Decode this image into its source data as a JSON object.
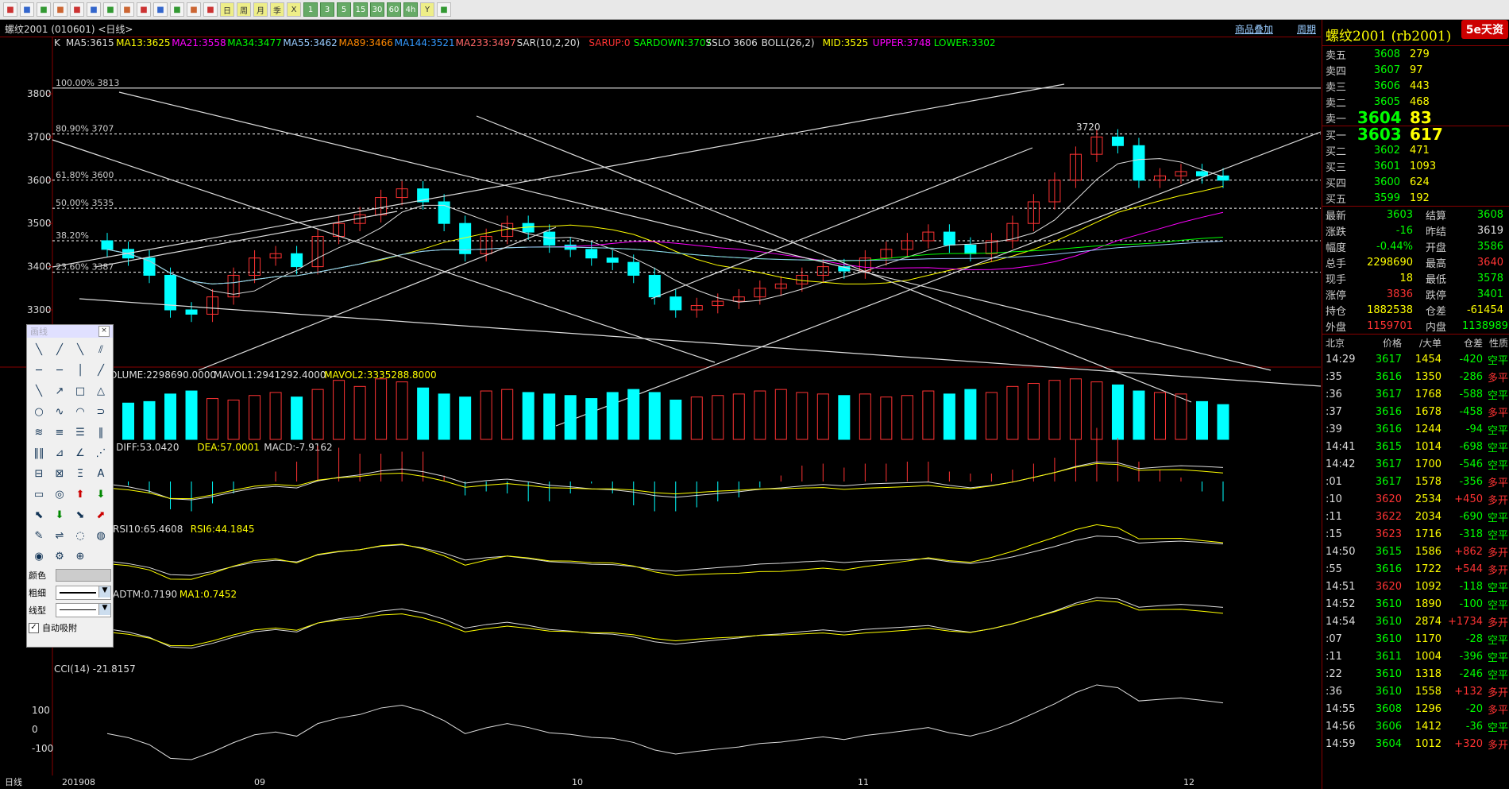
{
  "toolbar": {
    "buttons": [
      "home-icon",
      "back-icon",
      "list-icon",
      "refresh-icon",
      "zoom-in-icon",
      "zoom-out-icon",
      "window-icon",
      "pen-icon",
      "draw-icon",
      "mark-icon",
      "grid-icon",
      "table-icon",
      "chart-icon",
      "day-icon",
      "week-icon",
      "month-icon",
      "season-icon",
      "x-icon",
      "1-icon",
      "3-icon",
      "5-icon",
      "15-icon",
      "30-icon",
      "60-icon",
      "4h-icon",
      "y-icon",
      "calc-icon"
    ],
    "labels": [
      "",
      "",
      "",
      "",
      "",
      "",
      "",
      "",
      "",
      "",
      "",
      "",
      "",
      "日",
      "周",
      "月",
      "季",
      "X",
      "1",
      "3",
      "5",
      "15",
      "30",
      "60",
      "4h",
      "Y",
      ""
    ]
  },
  "title": {
    "text": "螺纹2001 (010601) <日线>",
    "overlay_link": "商品叠加",
    "period_link": "周期"
  },
  "indicators": {
    "main": "K  MA5:3615  MA13:3625  MA21:3558  MA34:3477  MA55:3462  MA89:3466  MA144:3521  MA233:3497  SAR(10,2,20)  SARUP:0  SARDOWN:3707  SSLO 3606  BOLL(26,2)  MID:3525  UPPER:3748  LOWER:3302",
    "main_parts": [
      {
        "t": "K",
        "c": "#ddd"
      },
      {
        "t": "MA5:3615",
        "c": "#ddd"
      },
      {
        "t": "MA13:3625",
        "c": "#ff0"
      },
      {
        "t": "MA21:3558",
        "c": "#f0f"
      },
      {
        "t": "MA34:3477",
        "c": "#0f0"
      },
      {
        "t": "MA55:3462",
        "c": "#9cf"
      },
      {
        "t": "MA89:3466",
        "c": "#f80"
      },
      {
        "t": "MA144:3521",
        "c": "#39f"
      },
      {
        "t": "MA233:3497",
        "c": "#f66"
      },
      {
        "t": "SAR(10,2,20)",
        "c": "#ddd"
      },
      {
        "t": "SARUP:0",
        "c": "#f33"
      },
      {
        "t": "SARDOWN:3707",
        "c": "#0f0"
      },
      {
        "t": "SSLO 3606",
        "c": "#ddd"
      },
      {
        "t": "BOLL(26,2)",
        "c": "#ddd"
      },
      {
        "t": "MID:3525",
        "c": "#ff0"
      },
      {
        "t": "UPPER:3748",
        "c": "#f0f"
      },
      {
        "t": "LOWER:3302",
        "c": "#0f0"
      }
    ],
    "volume": [
      {
        "t": "VOLUME:2298690.0000",
        "c": "#ddd"
      },
      {
        "t": "MAVOL1:2941292.4000",
        "c": "#ddd"
      },
      {
        "t": "MAVOL2:3335288.8000",
        "c": "#ff0"
      }
    ],
    "macd": [
      {
        "t": "9)  DIFF:53.0420",
        "c": "#ddd"
      },
      {
        "t": "DEA:57.0001",
        "c": "#ff0"
      },
      {
        "t": "MACD:-7.9162",
        "c": "#ddd"
      }
    ],
    "rsi": [
      {
        "t": "RSI10:65.4608",
        "c": "#ddd"
      },
      {
        "t": "RSI6:44.1845",
        "c": "#ff0"
      }
    ],
    "adtm": [
      {
        "t": "ADTM:0.7190",
        "c": "#ddd"
      },
      {
        "t": "MA1:0.7452",
        "c": "#ff0"
      }
    ],
    "cci": [
      {
        "t": "CCI(14)  -21.8157",
        "c": "#ddd"
      }
    ]
  },
  "price_axis": [
    "3800",
    "3700",
    "3600",
    "3500",
    "3400",
    "3300"
  ],
  "cci_axis": [
    "100",
    "0",
    "-100"
  ],
  "fib_labels": [
    "100.00% 3813",
    "80.90% 3707",
    "61.80% 3600",
    "50.00% 3535",
    "38.20%",
    "23.60% 3387"
  ],
  "peak_label": "3720",
  "date_axis": [
    "日线",
    "201908",
    "09",
    "10",
    "11",
    "12"
  ],
  "chart_data": {
    "type": "candlestick",
    "series_close": [
      3440,
      3420,
      3380,
      3300,
      3290,
      3330,
      3380,
      3420,
      3430,
      3400,
      3470,
      3500,
      3520,
      3560,
      3580,
      3550,
      3500,
      3430,
      3470,
      3500,
      3480,
      3450,
      3440,
      3420,
      3410,
      3380,
      3330,
      3300,
      3310,
      3320,
      3330,
      3350,
      3360,
      3380,
      3400,
      3390,
      3420,
      3440,
      3460,
      3480,
      3450,
      3430,
      3460,
      3500,
      3550,
      3600,
      3660,
      3700,
      3680,
      3600,
      3610,
      3620,
      3610,
      3600
    ],
    "volume": [
      2200000,
      2400000,
      2500000,
      3000000,
      3200000,
      2700000,
      2600000,
      2900000,
      3100000,
      2800000,
      3300000,
      3900000,
      3500000,
      4000000,
      3800000,
      3400000,
      3000000,
      2800000,
      3200000,
      3300000,
      3100000,
      3000000,
      2900000,
      2700000,
      3100000,
      3300000,
      3100000,
      2600000,
      2800000,
      2900000,
      3000000,
      3200000,
      3300000,
      3100000,
      3000000,
      2900000,
      3000000,
      2800000,
      2900000,
      3200000,
      3000000,
      3300000,
      3100000,
      3500000,
      3700000,
      3900000,
      4000000,
      3800000,
      3600000,
      3200000,
      3100000,
      3000000,
      2500000,
      2300000
    ]
  },
  "palette": {
    "title": "画线",
    "tools": [
      "line-segment-icon",
      "ray-icon",
      "diagonal-icon",
      "parallel-icon",
      "arrow-line-icon",
      "horizontal-icon",
      "vertical-icon",
      "extend-icon",
      "line-icon",
      "arrow-icon",
      "rectangle-icon",
      "triangle-icon",
      "ellipse-icon",
      "wave-icon",
      "curve-icon",
      "arc-icon",
      "fib-fan-icon",
      "fib-level-icon",
      "fib-retrace-icon",
      "period-icon",
      "cycle-icon",
      "gann-icon",
      "angle-icon",
      "gann-fan-icon",
      "channel-icon",
      "speed-icon",
      "regression-icon",
      "text-icon",
      "ruler-icon",
      "target-icon",
      "up-arrow-icon",
      "down-arrow-icon",
      "up-left-arrow-icon",
      "down-green-arrow-icon",
      "right-arrow-icon",
      "up-right-arrow-icon",
      "eraser-icon",
      "lock-icon",
      "hide-icon",
      "show-icon",
      "eye-icon",
      "gear-icon",
      "info-icon"
    ],
    "tool_glyphs": [
      "╲",
      "╱",
      "╲",
      "⫽",
      "─",
      "─",
      "│",
      "╱",
      "╲",
      "↗",
      "□",
      "△",
      "○",
      "∿",
      "◠",
      "⊃",
      "≋",
      "≡",
      "☰",
      "‖",
      "‖‖",
      "⊿",
      "∠",
      "⋰",
      "⊟",
      "⊠",
      "Ξ",
      "A",
      "▭",
      "◎",
      "⬆",
      "⬇",
      "⬉",
      "⬇",
      "⬊",
      "⬈",
      "✎",
      "⇌",
      "◌",
      "◍",
      "◉",
      "⚙",
      "⊕"
    ],
    "color_label": "颜色",
    "width_label": "粗细",
    "style_label": "线型",
    "auto_snap": "自动吸附"
  },
  "quote": {
    "name": "螺纹2001 (rb2001)",
    "logo": "5e天资",
    "asks": [
      {
        "label": "卖五",
        "price": "3608",
        "vol": "279"
      },
      {
        "label": "卖四",
        "price": "3607",
        "vol": "97"
      },
      {
        "label": "卖三",
        "price": "3606",
        "vol": "443"
      },
      {
        "label": "卖二",
        "price": "3605",
        "vol": "468"
      },
      {
        "label": "卖一",
        "price": "3604",
        "vol": "83"
      }
    ],
    "bids": [
      {
        "label": "买一",
        "price": "3603",
        "vol": "617"
      },
      {
        "label": "买二",
        "price": "3602",
        "vol": "471"
      },
      {
        "label": "买三",
        "price": "3601",
        "vol": "1093"
      },
      {
        "label": "买四",
        "price": "3600",
        "vol": "624"
      },
      {
        "label": "买五",
        "price": "3599",
        "vol": "192"
      }
    ],
    "stats": [
      {
        "l1": "最新",
        "v1": "3603",
        "c1": "#0f0",
        "l2": "结算",
        "v2": "3608",
        "c2": "#0f0"
      },
      {
        "l1": "涨跌",
        "v1": "-16",
        "c1": "#0f0",
        "l2": "昨结",
        "v2": "3619",
        "c2": "#ddd"
      },
      {
        "l1": "幅度",
        "v1": "-0.44%",
        "c1": "#0f0",
        "l2": "开盘",
        "v2": "3586",
        "c2": "#0f0"
      },
      {
        "l1": "总手",
        "v1": "2298690",
        "c1": "#ff0",
        "l2": "最高",
        "v2": "3640",
        "c2": "#f33"
      },
      {
        "l1": "现手",
        "v1": "18",
        "c1": "#ff0",
        "l2": "最低",
        "v2": "3578",
        "c2": "#0f0"
      },
      {
        "l1": "涨停",
        "v1": "3836",
        "c1": "#f33",
        "l2": "跌停",
        "v2": "3401",
        "c2": "#0f0"
      },
      {
        "l1": "持仓",
        "v1": "1882538",
        "c1": "#ff0",
        "l2": "仓差",
        "v2": "-61454",
        "c2": "#ff0"
      },
      {
        "l1": "外盘",
        "v1": "1159701",
        "c1": "#f33",
        "l2": "内盘",
        "v2": "1138989",
        "c2": "#0f0"
      }
    ],
    "tick_header": [
      "北京",
      "价格",
      "∕大单",
      "仓差",
      "性质"
    ],
    "ticks": [
      {
        "time": "14:29",
        "price": "3617",
        "vol": "1454",
        "chg": "-420",
        "type": "空平",
        "pc": "#0f0",
        "tc": "#0f0",
        "cc": "#0f0"
      },
      {
        "time": ":35",
        "price": "3616",
        "vol": "1350",
        "chg": "-286",
        "type": "多平",
        "pc": "#0f0",
        "tc": "#f33",
        "cc": "#0f0"
      },
      {
        "time": ":36",
        "price": "3617",
        "vol": "1768",
        "chg": "-588",
        "type": "空平",
        "pc": "#0f0",
        "tc": "#0f0",
        "cc": "#0f0"
      },
      {
        "time": ":37",
        "price": "3616",
        "vol": "1678",
        "chg": "-458",
        "type": "多平",
        "pc": "#0f0",
        "tc": "#f33",
        "cc": "#0f0"
      },
      {
        "time": ":39",
        "price": "3616",
        "vol": "1244",
        "chg": "-94",
        "type": "空平",
        "pc": "#0f0",
        "tc": "#0f0",
        "cc": "#0f0"
      },
      {
        "time": "14:41",
        "price": "3615",
        "vol": "1014",
        "chg": "-698",
        "type": "空平",
        "pc": "#0f0",
        "tc": "#0f0",
        "cc": "#0f0"
      },
      {
        "time": "14:42",
        "price": "3617",
        "vol": "1700",
        "chg": "-546",
        "type": "空平",
        "pc": "#0f0",
        "tc": "#0f0",
        "cc": "#0f0"
      },
      {
        "time": ":01",
        "price": "3617",
        "vol": "1578",
        "chg": "-356",
        "type": "多平",
        "pc": "#0f0",
        "tc": "#f33",
        "cc": "#0f0"
      },
      {
        "time": ":10",
        "price": "3620",
        "vol": "2534",
        "chg": "+450",
        "type": "多开",
        "pc": "#f33",
        "tc": "#f33",
        "cc": "#f33"
      },
      {
        "time": ":11",
        "price": "3622",
        "vol": "2034",
        "chg": "-690",
        "type": "空平",
        "pc": "#f33",
        "tc": "#0f0",
        "cc": "#0f0"
      },
      {
        "time": ":15",
        "price": "3623",
        "vol": "1716",
        "chg": "-318",
        "type": "空平",
        "pc": "#f33",
        "tc": "#0f0",
        "cc": "#0f0"
      },
      {
        "time": "14:50",
        "price": "3615",
        "vol": "1586",
        "chg": "+862",
        "type": "多开",
        "pc": "#0f0",
        "tc": "#f33",
        "cc": "#f33"
      },
      {
        "time": ":55",
        "price": "3616",
        "vol": "1722",
        "chg": "+544",
        "type": "多开",
        "pc": "#0f0",
        "tc": "#f33",
        "cc": "#f33"
      },
      {
        "time": "14:51",
        "price": "3620",
        "vol": "1092",
        "chg": "-118",
        "type": "空平",
        "pc": "#f33",
        "tc": "#0f0",
        "cc": "#0f0"
      },
      {
        "time": "14:52",
        "price": "3610",
        "vol": "1890",
        "chg": "-100",
        "type": "空平",
        "pc": "#0f0",
        "tc": "#0f0",
        "cc": "#0f0"
      },
      {
        "time": "14:54",
        "price": "3610",
        "vol": "2874",
        "chg": "+1734",
        "type": "多开",
        "pc": "#0f0",
        "tc": "#f33",
        "cc": "#f33"
      },
      {
        "time": ":07",
        "price": "3610",
        "vol": "1170",
        "chg": "-28",
        "type": "空平",
        "pc": "#0f0",
        "tc": "#0f0",
        "cc": "#0f0"
      },
      {
        "time": ":11",
        "price": "3611",
        "vol": "1004",
        "chg": "-396",
        "type": "空平",
        "pc": "#0f0",
        "tc": "#0f0",
        "cc": "#0f0"
      },
      {
        "time": ":22",
        "price": "3610",
        "vol": "1318",
        "chg": "-246",
        "type": "空平",
        "pc": "#0f0",
        "tc": "#0f0",
        "cc": "#0f0"
      },
      {
        "time": ":36",
        "price": "3610",
        "vol": "1558",
        "chg": "+132",
        "type": "多开",
        "pc": "#0f0",
        "tc": "#f33",
        "cc": "#f33"
      },
      {
        "time": "14:55",
        "price": "3608",
        "vol": "1296",
        "chg": "-20",
        "type": "多平",
        "pc": "#0f0",
        "tc": "#f33",
        "cc": "#0f0"
      },
      {
        "time": "14:56",
        "price": "3606",
        "vol": "1412",
        "chg": "-36",
        "type": "空平",
        "pc": "#0f0",
        "tc": "#0f0",
        "cc": "#0f0"
      },
      {
        "time": "14:59",
        "price": "3604",
        "vol": "1012",
        "chg": "+320",
        "type": "多开",
        "pc": "#0f0",
        "tc": "#f33",
        "cc": "#f33"
      }
    ]
  }
}
